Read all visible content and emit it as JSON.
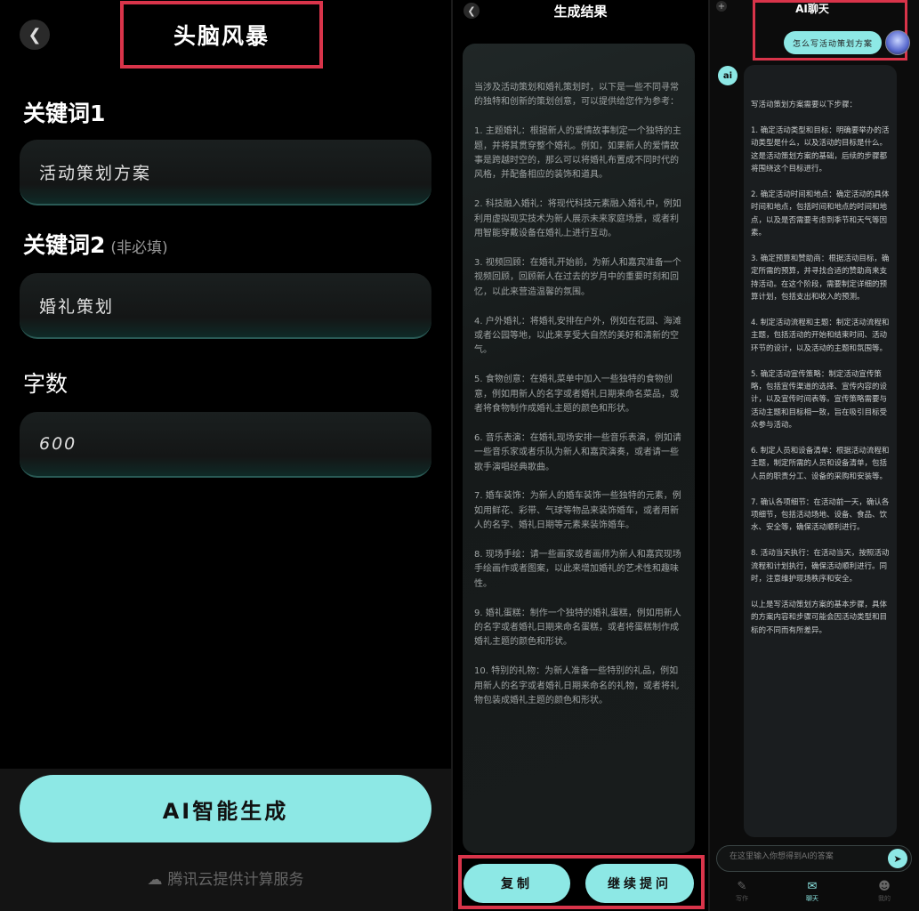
{
  "brainstorm": {
    "title": "头脑风暴",
    "keyword1_label": "关键词1",
    "keyword1_value": "活动策划方案",
    "keyword2_label": "关键词2",
    "keyword2_hint": "(非必填)",
    "keyword2_value": "婚礼策划",
    "wordcount_label": "字数",
    "wordcount_value": "600",
    "generate_button": "AI智能生成",
    "service_text": "腾讯云提供计算服务"
  },
  "result": {
    "title": "生成结果",
    "text": "当涉及活动策划和婚礼策划时，以下是一些不同寻常的独特和创新的策划创意，可以提供给您作为参考：\n\n1. 主题婚礼：根据新人的爱情故事制定一个独特的主题，并将其贯穿整个婚礼。例如，如果新人的爱情故事是跨越时空的，那么可以将婚礼布置成不同时代的风格，并配备相应的装饰和道具。\n\n2. 科技融入婚礼：将现代科技元素融入婚礼中，例如利用虚拟现实技术为新人展示未来家庭场景，或者利用智能穿戴设备在婚礼上进行互动。\n\n3. 视频回顾：在婚礼开始前，为新人和嘉宾准备一个视频回顾，回顾新人在过去的岁月中的重要时刻和回忆，以此来营造温馨的氛围。\n\n4. 户外婚礼：将婚礼安排在户外，例如在花园、海滩或者公园等地，以此来享受大自然的美好和清新的空气。\n\n5. 食物创意：在婚礼菜单中加入一些独特的食物创意，例如用新人的名字或者婚礼日期来命名菜品，或者将食物制作成婚礼主题的颜色和形状。\n\n6. 音乐表演：在婚礼现场安排一些音乐表演，例如请一些音乐家或者乐队为新人和嘉宾演奏，或者请一些歌手演唱经典歌曲。\n\n7. 婚车装饰：为新人的婚车装饰一些独特的元素，例如用鲜花、彩带、气球等物品来装饰婚车，或者用新人的名字、婚礼日期等元素来装饰婚车。\n\n8. 现场手绘：请一些画家或者画师为新人和嘉宾现场手绘画作或者图案，以此来增加婚礼的艺术性和趣味性。\n\n9. 婚礼蛋糕：制作一个独特的婚礼蛋糕，例如用新人的名字或者婚礼日期来命名蛋糕，或者将蛋糕制作成婚礼主题的颜色和形状。\n\n10. 特别的礼物：为新人准备一些特别的礼品，例如用新人的名字或者婚礼日期来命名的礼物，或者将礼物包装成婚礼主题的颜色和形状。",
    "copy_button": "复制",
    "continue_button": "继续提问"
  },
  "chat": {
    "title": "AI聊天",
    "user_message": "怎么写活动策划方案",
    "ai_avatar_text": "ai",
    "ai_reply": "写活动策划方案需要以下步骤：\n\n1. 确定活动类型和目标：明确要举办的活动类型是什么，以及活动的目标是什么。这是活动策划方案的基础，后续的步骤都将围绕这个目标进行。\n\n2. 确定活动时间和地点：确定活动的具体时间和地点，包括时间和地点的时间和地点，以及是否需要考虑到季节和天气等因素。\n\n3. 确定预算和赞助商：根据活动目标，确定所需的预算，并寻找合适的赞助商来支持活动。在这个阶段，需要制定详细的预算计划，包括支出和收入的预测。\n\n4. 制定活动流程和主题：制定活动流程和主题，包括活动的开始和结束时间、活动环节的设计，以及活动的主题和氛围等。\n\n5. 确定活动宣传策略：制定活动宣传策略，包括宣传渠道的选择、宣传内容的设计，以及宣传时间表等。宣传策略需要与活动主题和目标相一致，旨在吸引目标受众参与活动。\n\n6. 制定人员和设备清单：根据活动流程和主题，制定所需的人员和设备清单，包括人员的职责分工、设备的采购和安装等。\n\n7. 确认各项细节：在活动前一天，确认各项细节，包括活动场地、设备、食品、饮水、安全等，确保活动顺利进行。\n\n8. 活动当天执行：在活动当天，按照活动流程和计划执行，确保活动顺利进行。同时，注意维护现场秩序和安全。\n\n以上是写活动策划方案的基本步骤，具体的方案内容和步骤可能会因活动类型和目标的不同而有所差异。",
    "input_placeholder": "在这里输入你想得到AI的答案",
    "tabs": [
      "写作",
      "聊天",
      "我的"
    ]
  }
}
